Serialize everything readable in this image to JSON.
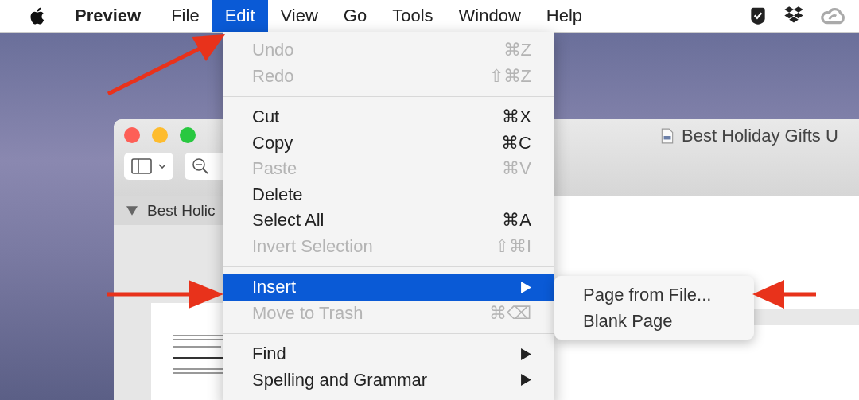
{
  "menu_bar": {
    "app_name": "Preview",
    "menus": [
      {
        "label": "File",
        "selected": false
      },
      {
        "label": "Edit",
        "selected": true
      },
      {
        "label": "View",
        "selected": false
      },
      {
        "label": "Go",
        "selected": false
      },
      {
        "label": "Tools",
        "selected": false
      },
      {
        "label": "Window",
        "selected": false
      },
      {
        "label": "Help",
        "selected": false
      }
    ]
  },
  "window": {
    "title": "Best Holiday Gifts U",
    "sidebar_header": "Best Holic"
  },
  "edit_menu": [
    {
      "kind": "item",
      "label": "Undo",
      "shortcut": "⌘Z",
      "disabled": true,
      "selected": false,
      "submenu": false
    },
    {
      "kind": "item",
      "label": "Redo",
      "shortcut": "⇧⌘Z",
      "disabled": true,
      "selected": false,
      "submenu": false
    },
    {
      "kind": "separator"
    },
    {
      "kind": "item",
      "label": "Cut",
      "shortcut": "⌘X",
      "disabled": false,
      "selected": false,
      "submenu": false
    },
    {
      "kind": "item",
      "label": "Copy",
      "shortcut": "⌘C",
      "disabled": false,
      "selected": false,
      "submenu": false
    },
    {
      "kind": "item",
      "label": "Paste",
      "shortcut": "⌘V",
      "disabled": true,
      "selected": false,
      "submenu": false
    },
    {
      "kind": "item",
      "label": "Delete",
      "disabled": false,
      "selected": false,
      "submenu": false
    },
    {
      "kind": "item",
      "label": "Select All",
      "shortcut": "⌘A",
      "disabled": false,
      "selected": false,
      "submenu": false
    },
    {
      "kind": "item",
      "label": "Invert Selection",
      "shortcut": "⇧⌘I",
      "disabled": true,
      "selected": false,
      "submenu": false
    },
    {
      "kind": "separator"
    },
    {
      "kind": "item",
      "label": "Insert",
      "disabled": false,
      "selected": true,
      "submenu": true
    },
    {
      "kind": "item",
      "label": "Move to Trash",
      "shortcut": "⌘⌫",
      "disabled": true,
      "selected": false,
      "submenu": false
    },
    {
      "kind": "separator"
    },
    {
      "kind": "item",
      "label": "Find",
      "disabled": false,
      "selected": false,
      "submenu": true
    },
    {
      "kind": "item",
      "label": "Spelling and Grammar",
      "disabled": false,
      "selected": false,
      "submenu": true
    }
  ],
  "insert_submenu": [
    "Page from File...",
    "Blank Page"
  ]
}
